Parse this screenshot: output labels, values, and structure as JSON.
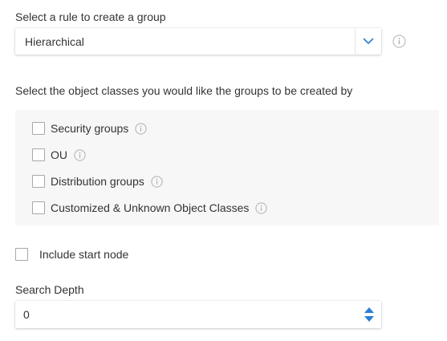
{
  "rule": {
    "label": "Select a rule to create a group",
    "selected_value": "Hierarchical",
    "dropdown_icon": "chevron-down-icon",
    "info_icon": "info-icon"
  },
  "object_classes": {
    "label": "Select the object classes you would like the groups to be created by",
    "items": [
      {
        "label": "Security groups",
        "checked": false
      },
      {
        "label": "OU",
        "checked": false
      },
      {
        "label": "Distribution groups",
        "checked": false
      },
      {
        "label": "Customized & Unknown Object Classes",
        "checked": false
      }
    ]
  },
  "include_start_node": {
    "label": "Include start node",
    "checked": false
  },
  "search_depth": {
    "label": "Search Depth",
    "value": "0",
    "spinner_icon": "up-down-arrows-icon"
  },
  "colors": {
    "accent": "#2a7fd4",
    "panel_bg": "#f7f7f8",
    "text": "#333333",
    "icon_gray": "#b0b0b0"
  }
}
